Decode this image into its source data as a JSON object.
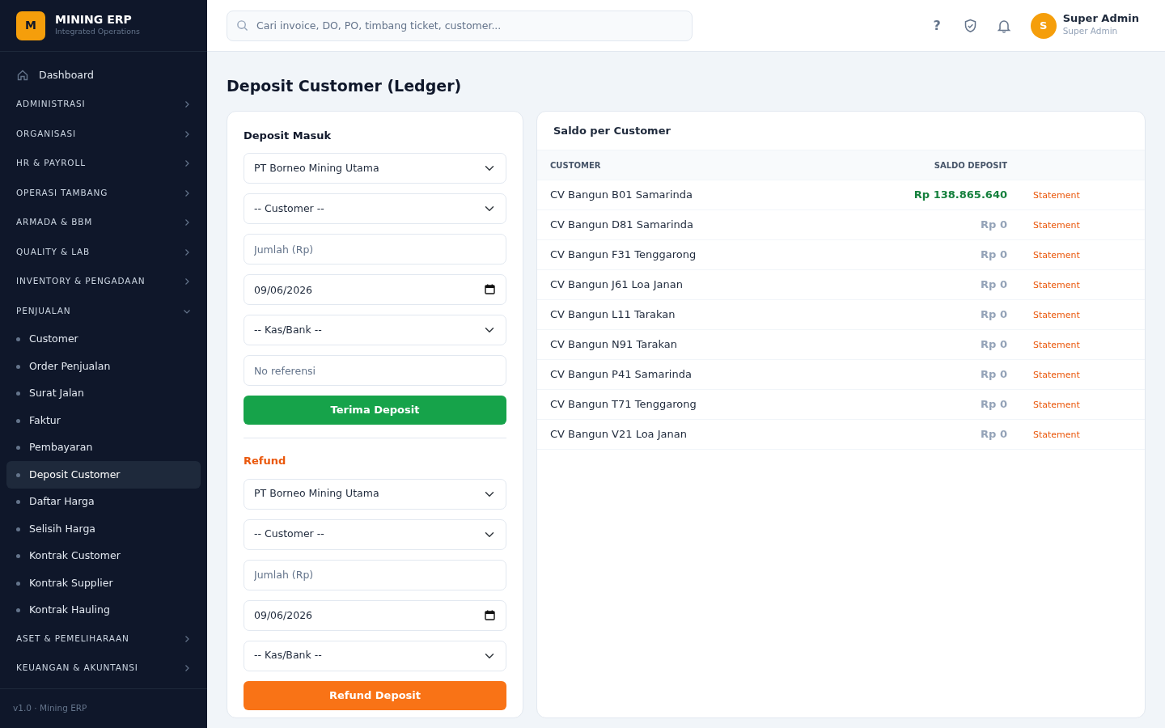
{
  "sidebar": {
    "brand": {
      "logo": "M",
      "title": "MINING ERP",
      "subtitle": "Integrated Operations"
    },
    "items": [
      {
        "kind": "link",
        "label": "Dashboard"
      },
      {
        "kind": "group",
        "label": "ADMINISTRASI",
        "expanded": false
      },
      {
        "kind": "group",
        "label": "ORGANISASI",
        "expanded": false
      },
      {
        "kind": "group",
        "label": "HR & PAYROLL",
        "expanded": false
      },
      {
        "kind": "group",
        "label": "OPERASI TAMBANG",
        "expanded": false
      },
      {
        "kind": "group",
        "label": "ARMADA & BBM",
        "expanded": false
      },
      {
        "kind": "group",
        "label": "QUALITY & LAB",
        "expanded": false
      },
      {
        "kind": "group",
        "label": "INVENTORY & PENGADAAN",
        "expanded": false
      },
      {
        "kind": "group",
        "label": "PENJUALAN",
        "expanded": true,
        "children": [
          {
            "label": "Customer",
            "selected": false
          },
          {
            "label": "Order Penjualan",
            "selected": false
          },
          {
            "label": "Surat Jalan",
            "selected": false
          },
          {
            "label": "Faktur",
            "selected": false
          },
          {
            "label": "Pembayaran",
            "selected": false
          },
          {
            "label": "Deposit Customer",
            "selected": true
          },
          {
            "label": "Daftar Harga",
            "selected": false
          },
          {
            "label": "Selisih Harga",
            "selected": false
          },
          {
            "label": "Kontrak Customer",
            "selected": false
          },
          {
            "label": "Kontrak Supplier",
            "selected": false
          },
          {
            "label": "Kontrak Hauling",
            "selected": false
          }
        ]
      },
      {
        "kind": "group",
        "label": "ASET & PEMELIHARAAN",
        "expanded": false
      },
      {
        "kind": "group",
        "label": "KEUANGAN & AKUNTANSI",
        "expanded": false
      }
    ],
    "footer": "v1.0 · Mining ERP"
  },
  "topbar": {
    "search": {
      "placeholder": "Cari invoice, DO, PO, timbang ticket, customer..."
    },
    "help": "?",
    "user": {
      "initial": "S",
      "name": "Super Admin",
      "role": "Super Admin"
    }
  },
  "page_title": "Deposit Customer (Ledger)",
  "forms": [
    {
      "kind": "deposit",
      "title": "Deposit Masuk",
      "fields": [
        {
          "kind": "select",
          "value": "PT Borneo Mining Utama"
        },
        {
          "kind": "select",
          "value": "-- Customer --"
        },
        {
          "kind": "input",
          "placeholder": "Jumlah (Rp)"
        },
        {
          "kind": "date",
          "value": "09/06/2026"
        },
        {
          "kind": "select",
          "value": "-- Kas/Bank --"
        },
        {
          "kind": "input",
          "placeholder": "No referensi"
        }
      ],
      "button": "Terima Deposit"
    },
    {
      "kind": "refund",
      "title": "Refund",
      "fields": [
        {
          "kind": "select",
          "value": "PT Borneo Mining Utama"
        },
        {
          "kind": "select",
          "value": "-- Customer --"
        },
        {
          "kind": "input",
          "placeholder": "Jumlah (Rp)"
        },
        {
          "kind": "date",
          "value": "09/06/2026"
        },
        {
          "kind": "select",
          "value": "-- Kas/Bank --"
        }
      ],
      "button": "Refund Deposit"
    }
  ],
  "balances": {
    "title": "Saldo per Customer",
    "columns": [
      "CUSTOMER",
      "SALDO DEPOSIT"
    ],
    "rows": [
      {
        "customer": "CV Bangun B01 Samarinda",
        "saldo": "Rp 138.865.640",
        "positive": true,
        "action": "Statement"
      },
      {
        "customer": "CV Bangun D81 Samarinda",
        "saldo": "Rp 0",
        "positive": false,
        "action": "Statement"
      },
      {
        "customer": "CV Bangun F31 Tenggarong",
        "saldo": "Rp 0",
        "positive": false,
        "action": "Statement"
      },
      {
        "customer": "CV Bangun J61 Loa Janan",
        "saldo": "Rp 0",
        "positive": false,
        "action": "Statement"
      },
      {
        "customer": "CV Bangun L11 Tarakan",
        "saldo": "Rp 0",
        "positive": false,
        "action": "Statement"
      },
      {
        "customer": "CV Bangun N91 Tarakan",
        "saldo": "Rp 0",
        "positive": false,
        "action": "Statement"
      },
      {
        "customer": "CV Bangun P41 Samarinda",
        "saldo": "Rp 0",
        "positive": false,
        "action": "Statement"
      },
      {
        "customer": "CV Bangun T71 Tenggarong",
        "saldo": "Rp 0",
        "positive": false,
        "action": "Statement"
      },
      {
        "customer": "CV Bangun V21 Loa Janan",
        "saldo": "Rp 0",
        "positive": false,
        "action": "Statement"
      }
    ]
  }
}
